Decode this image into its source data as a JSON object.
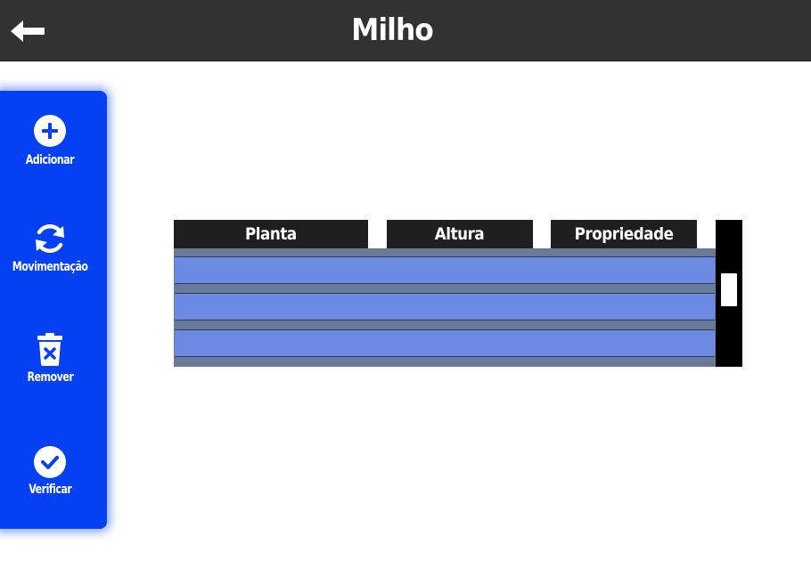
{
  "header": {
    "title": "Milho",
    "back_icon": "arrow-left-icon"
  },
  "colors": {
    "header_bg": "#323232",
    "sidebar_bg": "#0540f2",
    "row_bg": "#6c8ae4"
  },
  "sidebar": {
    "items": [
      {
        "label": "Adicionar",
        "icon": "plus-circle-icon"
      },
      {
        "label": "Movimentação",
        "icon": "sync-icon"
      },
      {
        "label": "Remover",
        "icon": "trash-icon"
      },
      {
        "label": "Verificar",
        "icon": "check-circle-icon"
      }
    ]
  },
  "table": {
    "columns": [
      "Planta",
      "Altura",
      "Propriedade"
    ],
    "rows": [
      [
        "",
        "",
        ""
      ],
      [
        "",
        "",
        ""
      ],
      [
        "",
        "",
        ""
      ]
    ]
  }
}
